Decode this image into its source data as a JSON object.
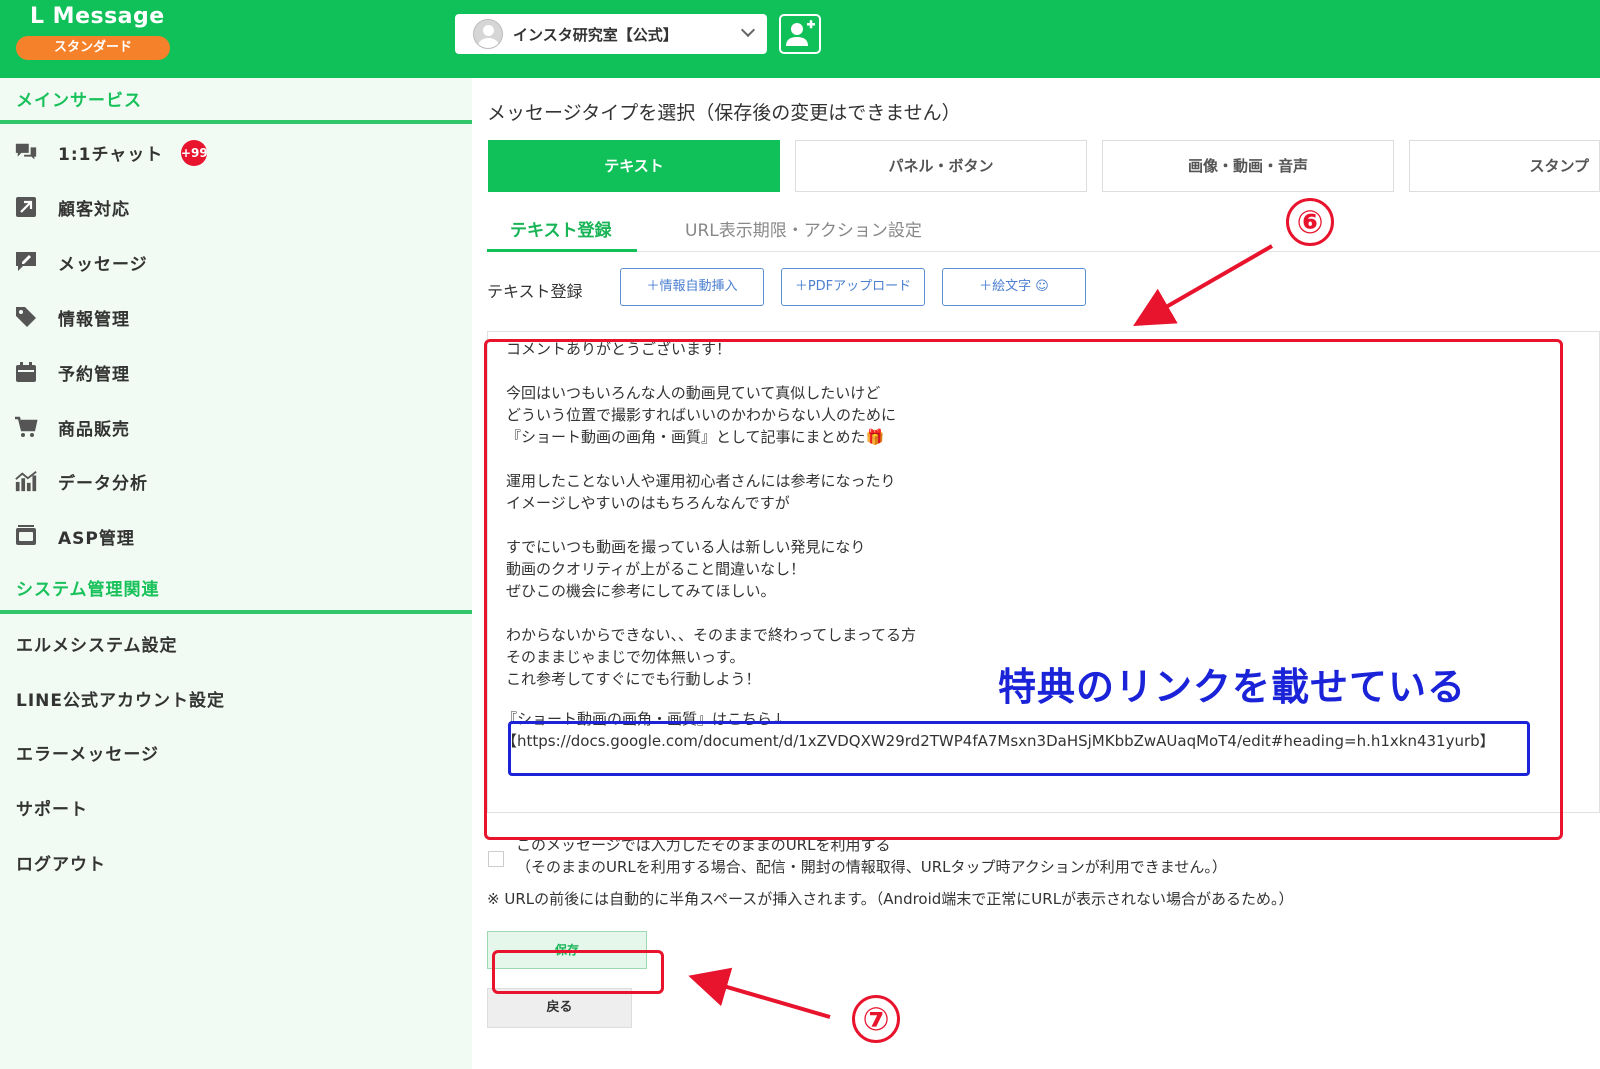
{
  "header": {
    "brand": "L Message",
    "plan": "スタンダード",
    "account_name": "インスタ研究室【公式】"
  },
  "sidebar": {
    "section_main": "メインサービス",
    "items": [
      {
        "label": "1:1チャット",
        "icon": "chat-icon"
      },
      {
        "label": "顧客対応",
        "icon": "arrow-box-icon"
      },
      {
        "label": "メッセージ",
        "icon": "message-edit-icon"
      },
      {
        "label": "情報管理",
        "icon": "tag-icon"
      },
      {
        "label": "予約管理",
        "icon": "calendar-icon"
      },
      {
        "label": "商品販売",
        "icon": "cart-icon"
      },
      {
        "label": "データ分析",
        "icon": "chart-icon"
      },
      {
        "label": "ASP管理",
        "icon": "asp-icon"
      }
    ],
    "chat_badge": "+99",
    "section_system": "システム管理関連",
    "system_items": [
      "エルメシステム設定",
      "LINE公式アカウント設定",
      "エラーメッセージ",
      "サポート",
      "ログアウト"
    ]
  },
  "main": {
    "heading": "メッセージタイプを選択（保存後の変更はできません）",
    "type_tabs": [
      "テキスト",
      "パネル・ボタン",
      "画像・動画・音声",
      "スタンプ"
    ],
    "sub_tabs": [
      "テキスト登録",
      "URL表示期限・アクション設定"
    ],
    "field_label": "テキスト登録",
    "tool_buttons": [
      "＋情報自動挿入",
      "＋PDFアップロード",
      "＋絵文字 ☺"
    ],
    "message_body": "コメントありがとうございます！\n\n今回はいつもいろんな人の動画見ていて真似したいけど\nどういう位置で撮影すればいいのかわからない人のために\n『ショート動画の画角・画質』として記事にまとめた🎁\n\n運用したことない人や運用初心者さんには参考になったり\nイメージしやすいのはもちろんなんですが\n\nすでにいつも動画を撮っている人は新しい発見になり\n動画のクオリティが上がること間違いなし！\nぜひこの機会に参考にしてみてほしい。\n\nわからないからできない、、そのままで終わってしまってる方\nそのままじゃまじで勿体無いっす。\nこれ参考してすぐにでも行動しよう！",
    "link_text": "『ショート動画の画角・画質』はこちら↓\n【https://docs.google.com/document/d/1xZVDQXW29rd2TWP4fA7Msxn3DaHSjMKbbZwAUaqMoT4/edit#heading=h.h1xkn431yurb】",
    "checkbox_text": "このメッセージでは入力したそのままのURLを利用する\n（そのままのURLを利用する場合、配信・開封の情報取得、URLタップ時アクションが利用できません。）",
    "note": "※ URLの前後には自動的に半角スペースが挿入されます。（Android端末で正常にURLが表示されない場合があるため。）",
    "save_label": "保存",
    "back_label": "戻る"
  },
  "annotations": {
    "callout": "特典のリンクを載せている",
    "step6": "⑥",
    "step7": "⑦"
  },
  "colors": {
    "brand_green": "#10c15a",
    "annotation_red": "#e8132c",
    "annotation_blue": "#1a23d8"
  }
}
